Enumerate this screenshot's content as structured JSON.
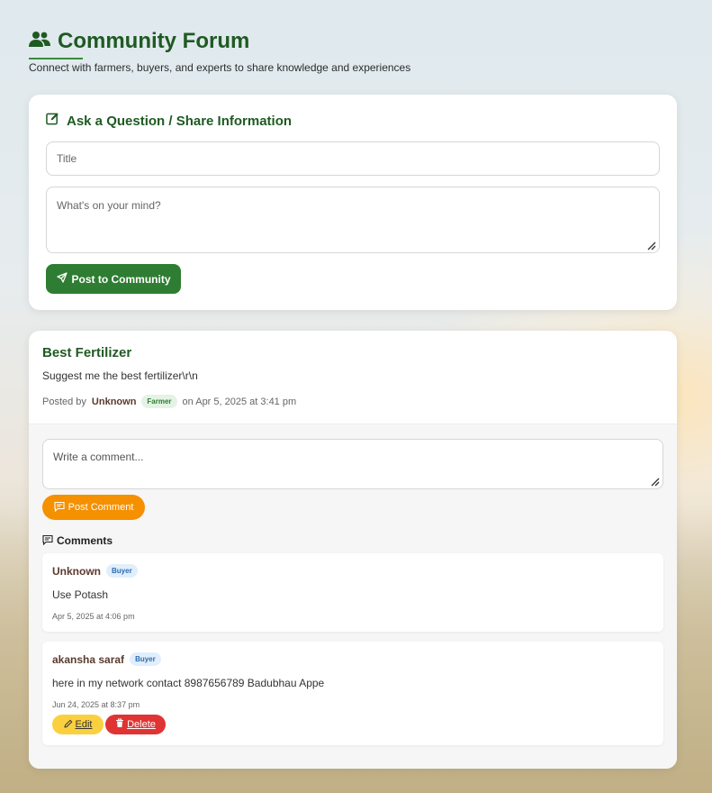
{
  "header": {
    "title": "Community Forum",
    "subtitle": "Connect with farmers, buyers, and experts to share knowledge and experiences",
    "icon": "users-icon"
  },
  "ask_form": {
    "heading": "Ask a Question / Share Information",
    "title_placeholder": "Title",
    "body_placeholder": "What's on your mind?",
    "submit_label": "Post to Community"
  },
  "post": {
    "title": "Best Fertilizer",
    "body": "Suggest me the best fertilizer\\r\\n",
    "posted_by_label": "Posted by",
    "author": "Unknown",
    "author_role": "Farmer",
    "date_text": "on Apr 5, 2025 at 3:41 pm",
    "comment_placeholder": "Write a comment...",
    "post_comment_label": "Post Comment",
    "comments_heading": "Comments",
    "comments": [
      {
        "author": "Unknown",
        "role": "Buyer",
        "text": "Use Potash",
        "time": "Apr 5, 2025 at 4:06 pm"
      },
      {
        "author": "akansha saraf",
        "role": "Buyer",
        "text": "here in my network contact 8987656789 Badubhau Appe",
        "time": "Jun 24, 2025 at 8:37 pm",
        "edit_label": "Edit",
        "delete_label": "Delete"
      }
    ]
  },
  "colors": {
    "brand_green": "#2e7d32",
    "title_green": "#1f5a23",
    "orange": "#f59000",
    "edit_yellow": "#fbd03f",
    "delete_red": "#e03434"
  }
}
